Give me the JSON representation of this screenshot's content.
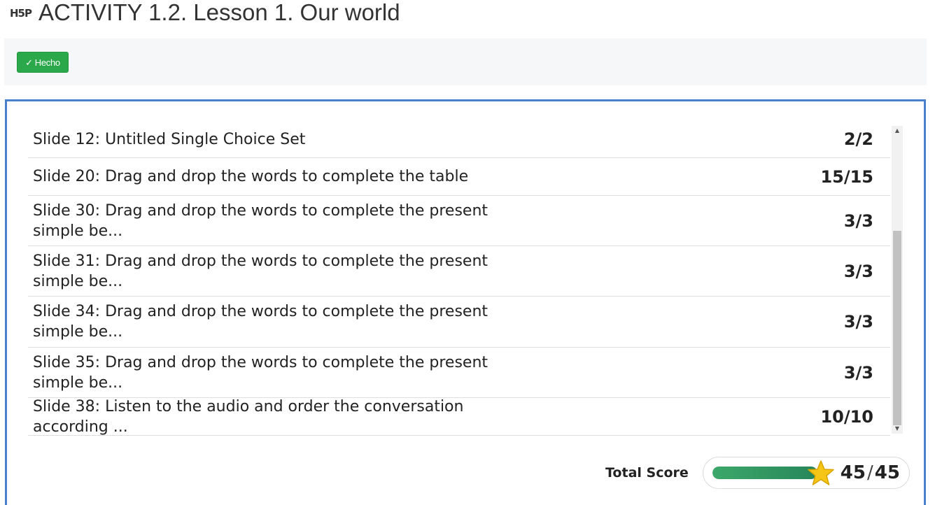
{
  "header": {
    "logo": "H5P",
    "title": "ACTIVITY 1.2. Lesson 1. Our world"
  },
  "toolbar": {
    "done_label": "Hecho"
  },
  "results": [
    {
      "title": "Slide 12: Untitled Single Choice Set",
      "score": "2/2"
    },
    {
      "title": "Slide 20: Drag and drop the words to complete the table",
      "score": "15/15"
    },
    {
      "title": "Slide 30: Drag and drop the words to complete the present simple be...",
      "score": "3/3"
    },
    {
      "title": "Slide 31: Drag and drop the words to complete the present simple be...",
      "score": "3/3"
    },
    {
      "title": "Slide 34: Drag and drop the words to complete the present simple be...",
      "score": "3/3"
    },
    {
      "title": "Slide 35: Drag and drop the words to complete the present simple be...",
      "score": "3/3"
    },
    {
      "title": "Slide 38: Listen to the audio and order the conversation according ...",
      "score": "10/10"
    }
  ],
  "total": {
    "label": "Total Score",
    "score": "45",
    "separator": "/",
    "max": "45",
    "progress_fraction": 1.0
  },
  "colors": {
    "accent_border": "#4a7fcc",
    "done_button": "#2aa84a",
    "progress_bar": "#27865a",
    "star": "#f5c518"
  },
  "icons": {
    "done": "check-icon",
    "total": "star-icon",
    "scroll_up": "scroll-up-arrow-icon",
    "scroll_down": "scroll-down-arrow-icon"
  }
}
